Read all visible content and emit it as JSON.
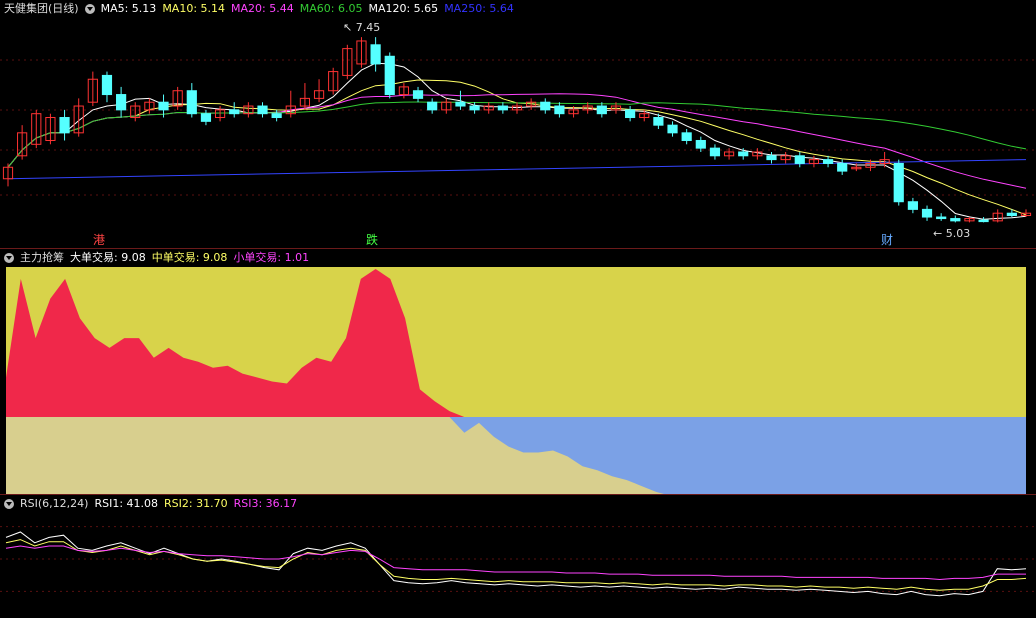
{
  "panel1": {
    "stock_name": "天健集团(日线)",
    "ma_items": [
      {
        "label": "MA5: 5.13",
        "color": "#ffffff"
      },
      {
        "label": "MA10: 5.14",
        "color": "#ffff66"
      },
      {
        "label": "MA20: 5.44",
        "color": "#ff44ff"
      },
      {
        "label": "MA60: 6.05",
        "color": "#33cc33"
      },
      {
        "label": "MA120: 5.65",
        "color": "#ffffff"
      },
      {
        "label": "MA250: 5.64",
        "color": "#3333ff"
      }
    ],
    "high_label": "7.45",
    "low_label": "5.03",
    "markers": [
      {
        "text": "港",
        "color": "#ff4444"
      },
      {
        "text": "跌",
        "color": "#44ff44"
      },
      {
        "text": "财",
        "color": "#66aaff"
      }
    ]
  },
  "panel2": {
    "title": "主力抢筹",
    "items": [
      {
        "label": "大单交易: 9.08",
        "color": "#ffffff"
      },
      {
        "label": "中单交易: 9.08",
        "color": "#ffff66"
      },
      {
        "label": "小单交易: 1.01",
        "color": "#ff44ff"
      }
    ]
  },
  "panel3": {
    "title": "RSI(6,12,24)",
    "items": [
      {
        "label": "RSI1: 41.08",
        "color": "#ffffff"
      },
      {
        "label": "RSI2: 31.70",
        "color": "#ffff66"
      },
      {
        "label": "RSI3: 36.17",
        "color": "#ff44ff"
      }
    ]
  },
  "colors": {
    "up": "#ff3333",
    "down": "#55ffff",
    "fill_upper": "#d8d34a",
    "fill_lower": "#d8cf8e",
    "red_area": "#f0284a",
    "blue_area": "#7ba1e6"
  },
  "chart_data": [
    {
      "type": "candlestick",
      "ylim": [
        4.8,
        7.7
      ],
      "candles": [
        [
          5.6,
          5.75,
          5.5,
          5.8
        ],
        [
          5.9,
          6.2,
          5.85,
          6.3
        ],
        [
          6.05,
          6.45,
          6.0,
          6.5
        ],
        [
          6.1,
          6.4,
          6.05,
          6.45
        ],
        [
          6.4,
          6.2,
          6.1,
          6.5
        ],
        [
          6.2,
          6.55,
          6.15,
          6.65
        ],
        [
          6.6,
          6.9,
          6.55,
          7.0
        ],
        [
          6.95,
          6.7,
          6.6,
          7.0
        ],
        [
          6.7,
          6.5,
          6.4,
          6.8
        ],
        [
          6.4,
          6.55,
          6.35,
          6.6
        ],
        [
          6.5,
          6.6,
          6.45,
          6.65
        ],
        [
          6.6,
          6.5,
          6.4,
          6.7
        ],
        [
          6.55,
          6.75,
          6.5,
          6.8
        ],
        [
          6.75,
          6.45,
          6.4,
          6.85
        ],
        [
          6.45,
          6.35,
          6.3,
          6.5
        ],
        [
          6.4,
          6.5,
          6.35,
          6.55
        ],
        [
          6.5,
          6.45,
          6.4,
          6.6
        ],
        [
          6.45,
          6.55,
          6.4,
          6.6
        ],
        [
          6.55,
          6.45,
          6.4,
          6.6
        ],
        [
          6.45,
          6.4,
          6.35,
          6.5
        ],
        [
          6.45,
          6.55,
          6.4,
          6.75
        ],
        [
          6.55,
          6.65,
          6.5,
          6.85
        ],
        [
          6.65,
          6.75,
          6.6,
          6.9
        ],
        [
          6.75,
          7.0,
          6.7,
          7.05
        ],
        [
          6.95,
          7.3,
          6.9,
          7.35
        ],
        [
          7.1,
          7.4,
          7.05,
          7.45
        ],
        [
          7.35,
          7.1,
          7.0,
          7.45
        ],
        [
          7.2,
          6.7,
          6.65,
          7.25
        ],
        [
          6.7,
          6.8,
          6.65,
          6.85
        ],
        [
          6.75,
          6.65,
          6.6,
          6.8
        ],
        [
          6.6,
          6.5,
          6.45,
          6.65
        ],
        [
          6.5,
          6.6,
          6.45,
          6.65
        ],
        [
          6.6,
          6.55,
          6.5,
          6.75
        ],
        [
          6.55,
          6.5,
          6.45,
          6.6
        ],
        [
          6.5,
          6.55,
          6.45,
          6.6
        ],
        [
          6.55,
          6.5,
          6.45,
          6.6
        ],
        [
          6.5,
          6.55,
          6.45,
          6.6
        ],
        [
          6.55,
          6.6,
          6.5,
          6.65
        ],
        [
          6.6,
          6.5,
          6.45,
          6.65
        ],
        [
          6.55,
          6.45,
          6.4,
          6.6
        ],
        [
          6.45,
          6.5,
          6.4,
          6.55
        ],
        [
          6.5,
          6.55,
          6.45,
          6.6
        ],
        [
          6.55,
          6.45,
          6.4,
          6.6
        ],
        [
          6.5,
          6.55,
          6.45,
          6.6
        ],
        [
          6.5,
          6.4,
          6.35,
          6.55
        ],
        [
          6.4,
          6.45,
          6.35,
          6.5
        ],
        [
          6.4,
          6.3,
          6.25,
          6.45
        ],
        [
          6.3,
          6.2,
          6.15,
          6.35
        ],
        [
          6.2,
          6.1,
          6.05,
          6.25
        ],
        [
          6.1,
          6.0,
          5.95,
          6.15
        ],
        [
          6.0,
          5.9,
          5.85,
          6.05
        ],
        [
          5.9,
          5.95,
          5.85,
          6.0
        ],
        [
          5.95,
          5.9,
          5.85,
          6.0
        ],
        [
          5.9,
          5.95,
          5.85,
          6.0
        ],
        [
          5.9,
          5.85,
          5.8,
          5.95
        ],
        [
          5.85,
          5.9,
          5.8,
          5.95
        ],
        [
          5.9,
          5.8,
          5.75,
          5.95
        ],
        [
          5.8,
          5.85,
          5.75,
          5.9
        ],
        [
          5.85,
          5.8,
          5.75,
          5.9
        ],
        [
          5.8,
          5.7,
          5.65,
          5.85
        ],
        [
          5.75,
          5.75,
          5.7,
          5.8
        ],
        [
          5.75,
          5.8,
          5.7,
          5.85
        ],
        [
          5.8,
          5.85,
          5.75,
          5.95
        ],
        [
          5.8,
          5.3,
          5.25,
          5.85
        ],
        [
          5.3,
          5.2,
          5.15,
          5.35
        ],
        [
          5.2,
          5.1,
          5.05,
          5.25
        ],
        [
          5.1,
          5.08,
          5.05,
          5.15
        ],
        [
          5.08,
          5.05,
          5.03,
          5.12
        ],
        [
          5.05,
          5.08,
          5.03,
          5.1
        ],
        [
          5.06,
          5.05,
          5.03,
          5.1
        ],
        [
          5.05,
          5.15,
          5.03,
          5.2
        ],
        [
          5.15,
          5.12,
          5.1,
          5.2
        ],
        [
          5.12,
          5.15,
          5.1,
          5.2
        ]
      ]
    },
    {
      "type": "area",
      "zero_line": true,
      "values": [
        20,
        70,
        40,
        60,
        70,
        50,
        40,
        35,
        40,
        40,
        30,
        35,
        30,
        28,
        25,
        26,
        22,
        20,
        18,
        17,
        25,
        30,
        28,
        40,
        70,
        75,
        70,
        50,
        14,
        8,
        3,
        -8,
        -3,
        -10,
        -15,
        -18,
        -18,
        -17,
        -20,
        -25,
        -27,
        -30,
        -32,
        -35,
        -38,
        -40,
        -42,
        -45,
        -50,
        -55,
        -58,
        -60,
        -62,
        -62,
        -63,
        -64,
        -65,
        -66,
        -67,
        -68,
        -70,
        -80,
        -80,
        -80,
        -80,
        -80,
        -80,
        -80,
        -80,
        -80
      ]
    },
    {
      "type": "line",
      "ylim": [
        0,
        100
      ],
      "series": [
        {
          "name": "RSI1",
          "values": [
            70,
            75,
            65,
            70,
            72,
            60,
            58,
            62,
            65,
            60,
            55,
            60,
            55,
            50,
            48,
            50,
            48,
            45,
            42,
            40,
            55,
            60,
            58,
            62,
            65,
            60,
            45,
            30,
            28,
            27,
            28,
            30,
            28,
            27,
            26,
            27,
            26,
            25,
            26,
            25,
            24,
            25,
            24,
            25,
            24,
            23,
            24,
            23,
            22,
            23,
            22,
            24,
            23,
            22,
            22,
            21,
            22,
            21,
            20,
            19,
            20,
            18,
            17,
            20,
            17,
            16,
            18,
            17,
            20,
            41,
            40,
            41
          ]
        },
        {
          "name": "RSI2",
          "values": [
            65,
            68,
            62,
            66,
            66,
            58,
            56,
            58,
            62,
            58,
            54,
            57,
            54,
            50,
            48,
            49,
            47,
            45,
            43,
            42,
            50,
            56,
            54,
            58,
            60,
            58,
            45,
            34,
            32,
            31,
            31,
            32,
            31,
            30,
            29,
            30,
            29,
            29,
            29,
            28,
            28,
            28,
            27,
            28,
            27,
            26,
            27,
            26,
            26,
            26,
            25,
            26,
            26,
            25,
            25,
            24,
            25,
            24,
            24,
            23,
            24,
            23,
            22,
            24,
            22,
            21,
            22,
            22,
            25,
            31,
            31,
            32
          ]
        },
        {
          "name": "RSI3",
          "values": [
            60,
            62,
            60,
            62,
            62,
            58,
            57,
            58,
            60,
            58,
            56,
            57,
            55,
            54,
            53,
            53,
            52,
            51,
            50,
            50,
            52,
            55,
            54,
            56,
            58,
            57,
            50,
            42,
            41,
            40,
            40,
            40,
            40,
            39,
            38,
            38,
            38,
            38,
            38,
            37,
            37,
            37,
            36,
            36,
            36,
            35,
            35,
            35,
            35,
            35,
            34,
            34,
            34,
            34,
            34,
            33,
            33,
            33,
            33,
            33,
            33,
            32,
            32,
            32,
            32,
            31,
            32,
            32,
            33,
            36,
            36,
            36
          ]
        }
      ]
    }
  ]
}
